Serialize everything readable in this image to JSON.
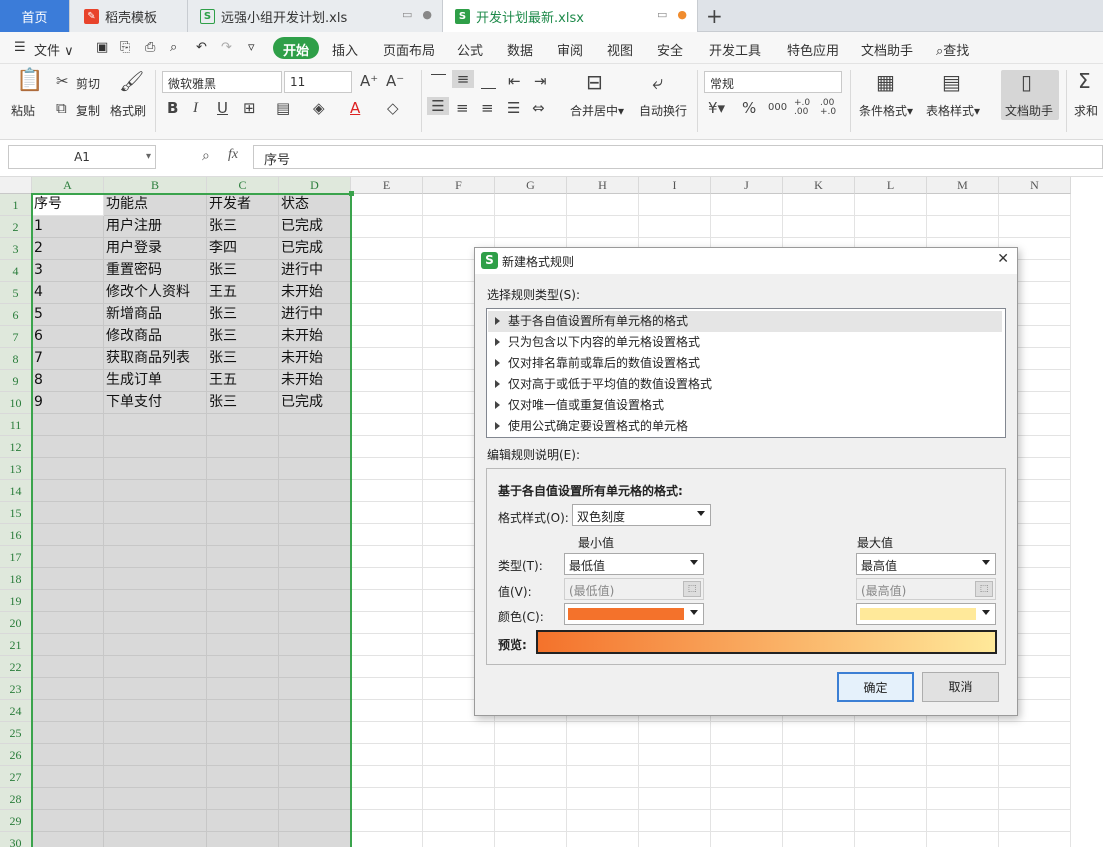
{
  "tabs": [
    {
      "label": "首页"
    },
    {
      "label": "稻壳模板"
    },
    {
      "label": "远强小组开发计划.xls"
    },
    {
      "label": "开发计划最新.xlsx"
    }
  ],
  "new_tab_symbol": "+",
  "menu": {
    "file": "文件",
    "items": [
      "开始",
      "插入",
      "页面布局",
      "公式",
      "数据",
      "审阅",
      "视图",
      "安全",
      "开发工具",
      "特色应用",
      "文档助手"
    ],
    "search": "查找"
  },
  "ribbon": {
    "paste": "粘贴",
    "cut": "剪切",
    "copy": "复制",
    "format_painter": "格式刷",
    "font_name": "微软雅黑",
    "font_size": "11",
    "merge_center": "合并居中",
    "wrap_text": "自动换行",
    "number_format": "常规",
    "conditional_format": "条件格式",
    "table_style": "表格样式",
    "doc_assistant": "文档助手",
    "sum": "求和",
    "bold": "B",
    "italic": "I",
    "underline": "U",
    "percent": "%",
    "thousands": "000",
    "inc_decimal": "+.0 .00",
    "dec_decimal": ".00 +.0"
  },
  "formula_bar": {
    "name_box": "A1",
    "fx": "fx",
    "content": "序号"
  },
  "columns": [
    "A",
    "B",
    "C",
    "D",
    "E",
    "F",
    "G",
    "H",
    "I",
    "J",
    "K",
    "L",
    "M",
    "N"
  ],
  "rows": [
    "1",
    "2",
    "3",
    "4",
    "5",
    "6",
    "7",
    "8",
    "9",
    "10",
    "11",
    "12",
    "13",
    "14",
    "15",
    "16",
    "17",
    "18",
    "19",
    "20",
    "21",
    "22",
    "23",
    "24",
    "25",
    "26",
    "27",
    "28",
    "29",
    "30"
  ],
  "sheet": [
    [
      "序号",
      "功能点",
      "开发者",
      "状态"
    ],
    [
      "1",
      "用户注册",
      "张三",
      "已完成"
    ],
    [
      "2",
      "用户登录",
      "李四",
      "已完成"
    ],
    [
      "3",
      "重置密码",
      "张三",
      "进行中"
    ],
    [
      "4",
      "修改个人资料",
      "王五",
      "未开始"
    ],
    [
      "5",
      "新增商品",
      "张三",
      "进行中"
    ],
    [
      "6",
      "修改商品",
      "张三",
      "未开始"
    ],
    [
      "7",
      "获取商品列表",
      "张三",
      "未开始"
    ],
    [
      "8",
      "生成订单",
      "王五",
      "未开始"
    ],
    [
      "9",
      "下单支付",
      "张三",
      "已完成"
    ]
  ],
  "dialog": {
    "title": "新建格式规则",
    "close_symbol": "✕",
    "select_rule_type_label": "选择规则类型(S):",
    "rule_types": [
      "基于各自值设置所有单元格的格式",
      "只为包含以下内容的单元格设置格式",
      "仅对排名靠前或靠后的数值设置格式",
      "仅对高于或低于平均值的数值设置格式",
      "仅对唯一值或重复值设置格式",
      "使用公式确定要设置格式的单元格"
    ],
    "edit_rule_label": "编辑规则说明(E):",
    "desc_heading": "基于各自值设置所有单元格的格式:",
    "format_style_label": "格式样式(O):",
    "format_style_value": "双色刻度",
    "min_heading": "最小值",
    "max_heading": "最大值",
    "type_label": "类型(T):",
    "value_label": "值(V):",
    "color_label": "颜色(C):",
    "min_type": "最低值",
    "max_type": "最高值",
    "min_value_placeholder": "(最低值)",
    "max_value_placeholder": "(最高值)",
    "min_color": "#f4722b",
    "max_color": "#ffe99a",
    "preview_label": "预览:",
    "ok": "确定",
    "cancel": "取消"
  },
  "colors": {
    "accent": "#2f9f48",
    "home_tab": "#3b7cd9",
    "selection_border": "#3aa34c"
  }
}
